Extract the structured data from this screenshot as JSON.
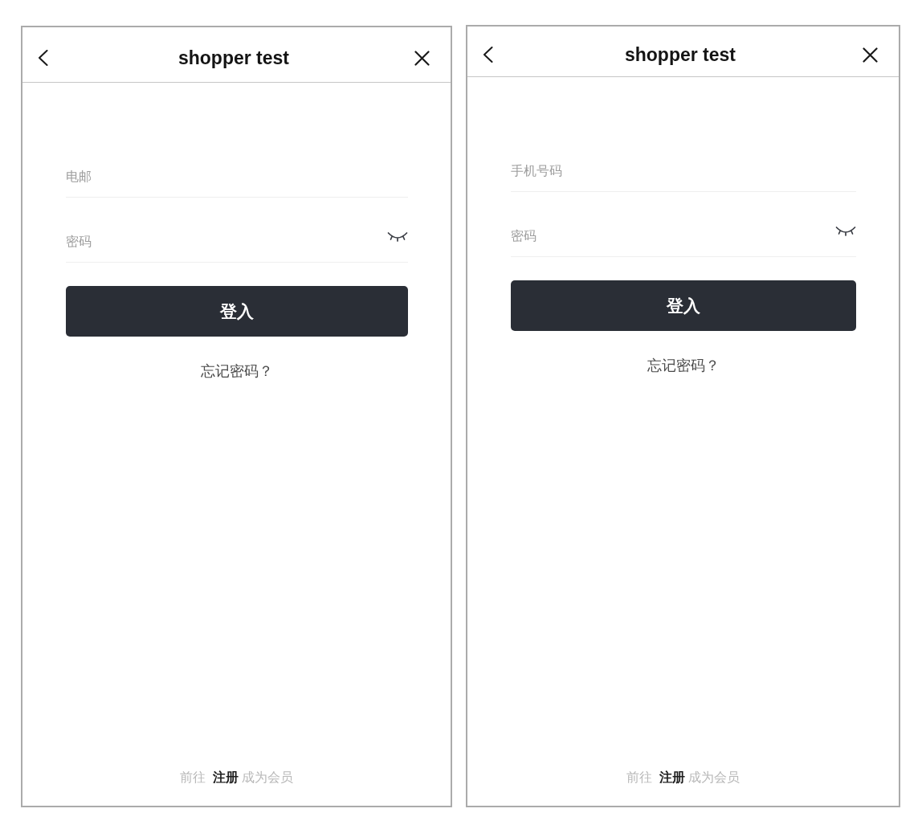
{
  "screens": [
    {
      "header": {
        "title": "shopper test"
      },
      "fields": [
        {
          "kind": "text",
          "placeholder": "电邮"
        },
        {
          "kind": "password",
          "placeholder": "密码",
          "revealed": false
        }
      ],
      "login_button": "登入",
      "forgot_password_link": "忘记密码？",
      "footer": {
        "prefix": "前往",
        "link": "注册",
        "suffix": "成为会员"
      }
    },
    {
      "header": {
        "title": "shopper test"
      },
      "fields": [
        {
          "kind": "text",
          "placeholder": "手机号码"
        },
        {
          "kind": "password",
          "placeholder": "密码",
          "revealed": false
        }
      ],
      "login_button": "登入",
      "forgot_password_link": "忘记密码？",
      "footer": {
        "prefix": "前往",
        "link": "注册",
        "suffix": "成为会员"
      }
    }
  ]
}
